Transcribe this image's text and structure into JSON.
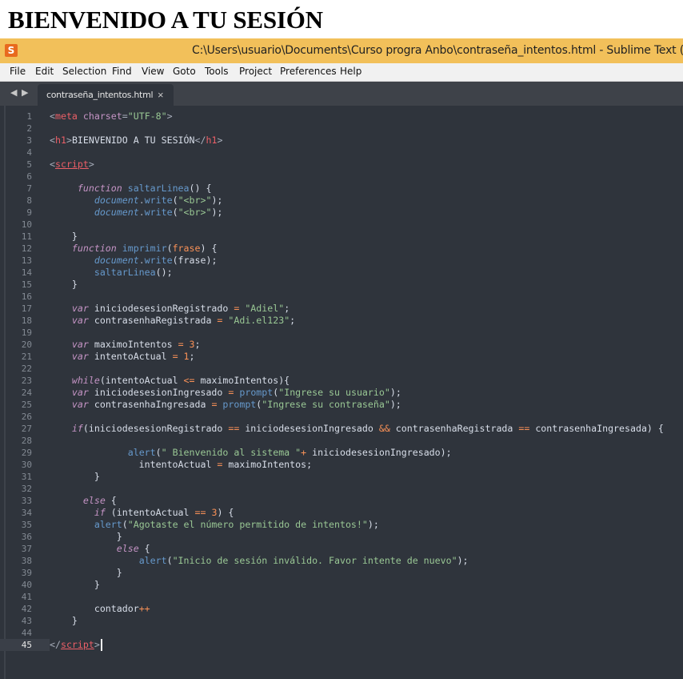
{
  "page": {
    "heading": "BIENVENIDO A TU SESIÓN"
  },
  "window": {
    "title": "C:\\Users\\usuario\\Documents\\Curso progra Anbo\\contraseña_intentos.html - Sublime Text (UN",
    "app_icon": "sublime-text-logo-icon"
  },
  "menu": [
    "File",
    "Edit",
    "Selection",
    "Find",
    "View",
    "Goto",
    "Tools",
    "Project",
    "Preferences",
    "Help"
  ],
  "tabs": [
    {
      "label": "contraseña_intentos.html",
      "close": "×",
      "active": true
    }
  ],
  "nav": {
    "back": "◀",
    "forward": "▶"
  },
  "editor": {
    "active_line": 45,
    "lines": [
      [
        [
          "punc",
          "<"
        ],
        [
          "tag",
          "meta"
        ],
        [
          "t",
          " "
        ],
        [
          "attr",
          "charset"
        ],
        [
          "punc",
          "="
        ],
        [
          "str",
          "\"UTF-8\""
        ],
        [
          "punc",
          ">"
        ]
      ],
      [],
      [
        [
          "punc",
          "<"
        ],
        [
          "tag",
          "h1"
        ],
        [
          "punc",
          ">"
        ],
        [
          "t",
          "BIENVENIDO A TU SESIÓN"
        ],
        [
          "punc",
          "</"
        ],
        [
          "tag",
          "h1"
        ],
        [
          "punc",
          ">"
        ]
      ],
      [],
      [
        [
          "punc",
          "<"
        ],
        [
          "tagu",
          "script"
        ],
        [
          "punc",
          ">"
        ]
      ],
      [],
      [
        [
          "t",
          "     "
        ],
        [
          "kw",
          "function"
        ],
        [
          "t",
          " "
        ],
        [
          "fn",
          "saltarLinea"
        ],
        [
          "t",
          "() {"
        ]
      ],
      [
        [
          "t",
          "        "
        ],
        [
          "obj",
          "document"
        ],
        [
          "punc",
          "."
        ],
        [
          "fn",
          "write"
        ],
        [
          "t",
          "("
        ],
        [
          "str",
          "\"<br>\""
        ],
        [
          "t",
          ");"
        ]
      ],
      [
        [
          "t",
          "        "
        ],
        [
          "obj",
          "document"
        ],
        [
          "punc",
          "."
        ],
        [
          "fn",
          "write"
        ],
        [
          "t",
          "("
        ],
        [
          "str",
          "\"<br>\""
        ],
        [
          "t",
          ");"
        ]
      ],
      [],
      [
        [
          "t",
          "    }"
        ]
      ],
      [
        [
          "t",
          "    "
        ],
        [
          "kw",
          "function"
        ],
        [
          "t",
          " "
        ],
        [
          "fn",
          "imprimir"
        ],
        [
          "t",
          "("
        ],
        [
          "par",
          "frase"
        ],
        [
          "t",
          ") {"
        ]
      ],
      [
        [
          "t",
          "        "
        ],
        [
          "obj",
          "document"
        ],
        [
          "punc",
          "."
        ],
        [
          "fn",
          "write"
        ],
        [
          "t",
          "(frase);"
        ]
      ],
      [
        [
          "t",
          "        "
        ],
        [
          "fn",
          "saltarLinea"
        ],
        [
          "t",
          "();"
        ]
      ],
      [
        [
          "t",
          "    }"
        ]
      ],
      [],
      [
        [
          "t",
          "    "
        ],
        [
          "kw",
          "var"
        ],
        [
          "t",
          " iniciodesesionRegistrado "
        ],
        [
          "op",
          "="
        ],
        [
          "t",
          " "
        ],
        [
          "str",
          "\"Adiel\""
        ],
        [
          "t",
          ";"
        ]
      ],
      [
        [
          "t",
          "    "
        ],
        [
          "kw",
          "var"
        ],
        [
          "t",
          " contrasenhaRegistrada "
        ],
        [
          "op",
          "="
        ],
        [
          "t",
          " "
        ],
        [
          "str",
          "\"Adi.el123\""
        ],
        [
          "t",
          ";"
        ]
      ],
      [],
      [
        [
          "t",
          "    "
        ],
        [
          "kw",
          "var"
        ],
        [
          "t",
          " maximoIntentos "
        ],
        [
          "op",
          "="
        ],
        [
          "t",
          " "
        ],
        [
          "num",
          "3"
        ],
        [
          "t",
          ";"
        ]
      ],
      [
        [
          "t",
          "    "
        ],
        [
          "kw",
          "var"
        ],
        [
          "t",
          " intentoActual "
        ],
        [
          "op",
          "="
        ],
        [
          "t",
          " "
        ],
        [
          "num",
          "1"
        ],
        [
          "t",
          ";"
        ]
      ],
      [],
      [
        [
          "t",
          "    "
        ],
        [
          "kw",
          "while"
        ],
        [
          "t",
          "(intentoActual "
        ],
        [
          "op",
          "<="
        ],
        [
          "t",
          " maximoIntentos){"
        ]
      ],
      [
        [
          "t",
          "    "
        ],
        [
          "kw",
          "var"
        ],
        [
          "t",
          " iniciodesesionIngresado "
        ],
        [
          "op",
          "="
        ],
        [
          "t",
          " "
        ],
        [
          "fn",
          "prompt"
        ],
        [
          "t",
          "("
        ],
        [
          "str",
          "\"Ingrese su usuario\""
        ],
        [
          "t",
          ");"
        ]
      ],
      [
        [
          "t",
          "    "
        ],
        [
          "kw",
          "var"
        ],
        [
          "t",
          " contrasenhaIngresada "
        ],
        [
          "op",
          "="
        ],
        [
          "t",
          " "
        ],
        [
          "fn",
          "prompt"
        ],
        [
          "t",
          "("
        ],
        [
          "str",
          "\"Ingrese su contraseña\""
        ],
        [
          "t",
          ");"
        ]
      ],
      [],
      [
        [
          "t",
          "    "
        ],
        [
          "kw",
          "if"
        ],
        [
          "t",
          "(iniciodesesionRegistrado "
        ],
        [
          "op",
          "=="
        ],
        [
          "t",
          " iniciodesesionIngresado "
        ],
        [
          "op",
          "&&"
        ],
        [
          "t",
          " contrasenhaRegistrada "
        ],
        [
          "op",
          "=="
        ],
        [
          "t",
          " contrasenhaIngresada) {"
        ]
      ],
      [],
      [
        [
          "t",
          "              "
        ],
        [
          "fn",
          "alert"
        ],
        [
          "t",
          "("
        ],
        [
          "str",
          "\" Bienvenido al sistema \""
        ],
        [
          "op",
          "+"
        ],
        [
          "t",
          " iniciodesesionIngresado);"
        ]
      ],
      [
        [
          "t",
          "                intentoActual "
        ],
        [
          "op",
          "="
        ],
        [
          "t",
          " maximoIntentos;"
        ]
      ],
      [
        [
          "t",
          "        }"
        ]
      ],
      [],
      [
        [
          "t",
          "      "
        ],
        [
          "kw",
          "else"
        ],
        [
          "t",
          " {"
        ]
      ],
      [
        [
          "t",
          "        "
        ],
        [
          "kw",
          "if"
        ],
        [
          "t",
          " (intentoActual "
        ],
        [
          "op",
          "=="
        ],
        [
          "t",
          " "
        ],
        [
          "num",
          "3"
        ],
        [
          "t",
          ") {"
        ]
      ],
      [
        [
          "t",
          "        "
        ],
        [
          "fn",
          "alert"
        ],
        [
          "t",
          "("
        ],
        [
          "str",
          "\"Agotaste el número permitido de intentos!\""
        ],
        [
          "t",
          ");"
        ]
      ],
      [
        [
          "t",
          "            }"
        ]
      ],
      [
        [
          "t",
          "            "
        ],
        [
          "kw",
          "else"
        ],
        [
          "t",
          " {"
        ]
      ],
      [
        [
          "t",
          "                "
        ],
        [
          "fn",
          "alert"
        ],
        [
          "t",
          "("
        ],
        [
          "str",
          "\"Inicio de sesión inválido. Favor intente de nuevo\""
        ],
        [
          "t",
          ");"
        ]
      ],
      [
        [
          "t",
          "            }"
        ]
      ],
      [
        [
          "t",
          "        }"
        ]
      ],
      [],
      [
        [
          "t",
          "        contador"
        ],
        [
          "op",
          "++"
        ]
      ],
      [
        [
          "t",
          "    }"
        ]
      ],
      [],
      [
        [
          "punc",
          "</"
        ],
        [
          "tagu",
          "script"
        ],
        [
          "punc",
          ">"
        ]
      ]
    ]
  }
}
